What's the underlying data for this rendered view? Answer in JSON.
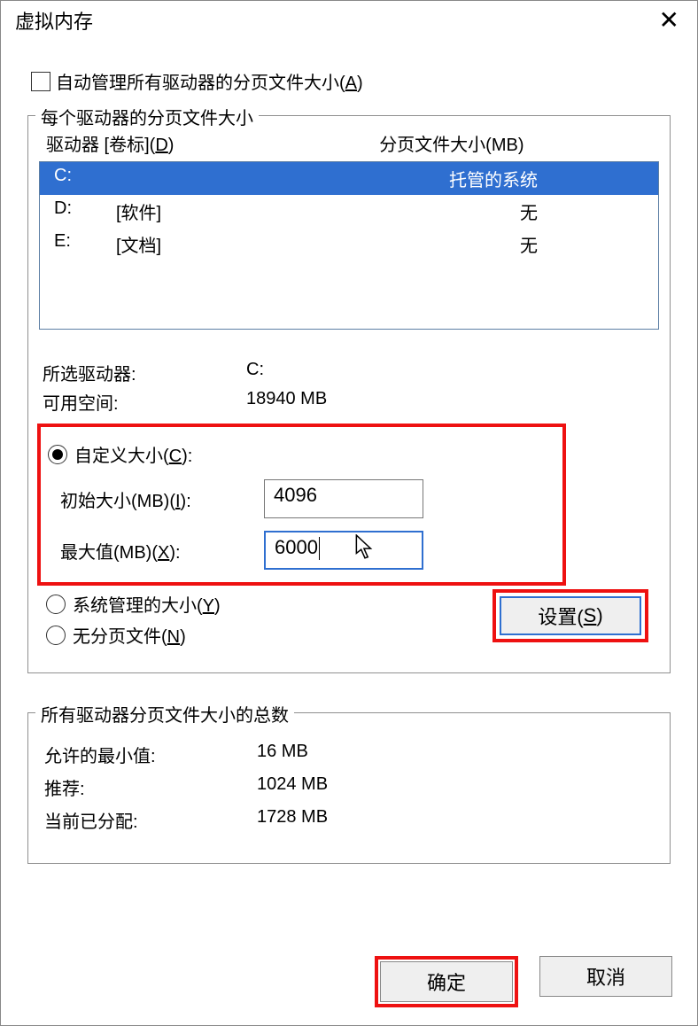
{
  "title": "虚拟内存",
  "auto_manage": {
    "checked": false,
    "label_pre": "自动管理所有驱动器的分页文件大小(",
    "accel": "A",
    "label_post": ")"
  },
  "per_drive": {
    "legend": "每个驱动器的分页文件大小",
    "header_drive_pre": "驱动器 [卷标](",
    "header_drive_accel": "D",
    "header_drive_post": ")",
    "header_size": "分页文件大小(MB)",
    "rows": [
      {
        "letter": "C:",
        "label": "",
        "size": "托管的系统",
        "selected": true
      },
      {
        "letter": "D:",
        "label": "[软件]",
        "size": "无",
        "selected": false
      },
      {
        "letter": "E:",
        "label": "[文档]",
        "size": "无",
        "selected": false
      }
    ]
  },
  "selected": {
    "drive_label": "所选驱动器:",
    "drive_value": "C:",
    "space_label": "可用空间:",
    "space_value": "18940 MB"
  },
  "options": {
    "custom_pre": "自定义大小(",
    "custom_accel": "C",
    "custom_post": "):",
    "initial_pre": "初始大小(MB)(",
    "initial_accel": "I",
    "initial_post": "):",
    "initial_value": "4096",
    "max_pre": "最大值(MB)(",
    "max_accel": "X",
    "max_post": "):",
    "max_value": "6000",
    "system_pre": "系统管理的大小(",
    "system_accel": "Y",
    "system_post": ")",
    "none_pre": "无分页文件(",
    "none_accel": "N",
    "none_post": ")",
    "selected_option": "custom"
  },
  "set_button_pre": "设置(",
  "set_button_accel": "S",
  "set_button_post": ")",
  "totals": {
    "legend": "所有驱动器分页文件大小的总数",
    "min_label": "允许的最小值:",
    "min_value": "16 MB",
    "rec_label": "推荐:",
    "rec_value": "1024 MB",
    "cur_label": "当前已分配:",
    "cur_value": "1728 MB"
  },
  "footer": {
    "ok": "确定",
    "cancel": "取消"
  }
}
